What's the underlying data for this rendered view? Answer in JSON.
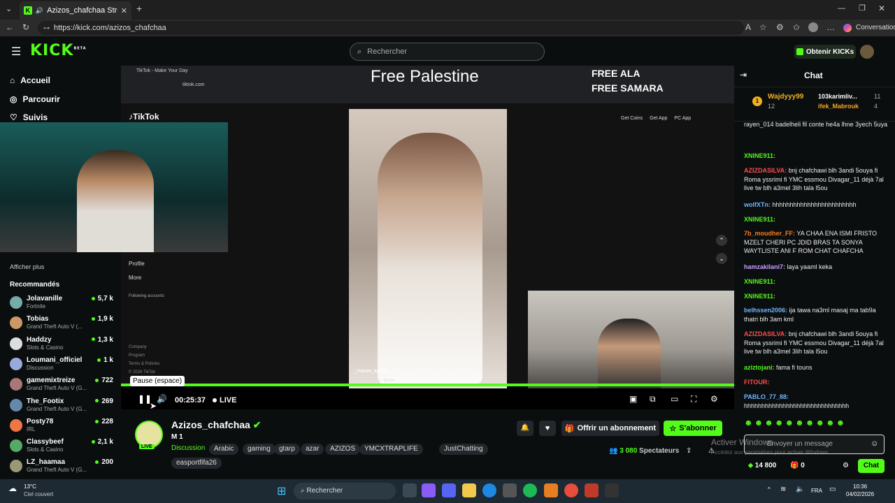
{
  "browser": {
    "tab_title": "Azizos_chafchaa Stream - Wa",
    "url": "https://kick.com/azizos_chafchaa",
    "conversation_label": "Conversation"
  },
  "header": {
    "logo": "KICK",
    "logo_beta": "BETA",
    "search_placeholder": "Rechercher",
    "get_kicks": "Obtenir KICKs"
  },
  "sidebar": {
    "nav": [
      "Accueil",
      "Parcourir",
      "Suivis"
    ],
    "show_more": "Afficher plus",
    "recommended_title": "Recommandés",
    "recommended": [
      {
        "name": "Jolavanille",
        "category": "Fortnite",
        "viewers": "5,7 k"
      },
      {
        "name": "Tobias",
        "category": "Grand Theft Auto V (...",
        "viewers": "1,9 k"
      },
      {
        "name": "Haddzy",
        "category": "Slots & Casino",
        "viewers": "1,3 k"
      },
      {
        "name": "Loumani_officiel",
        "category": "Discussion",
        "viewers": "1 k"
      },
      {
        "name": "gamemixtreize",
        "category": "Grand Theft Auto V (G...",
        "viewers": "722"
      },
      {
        "name": "The_Footix",
        "category": "Grand Theft Auto V (G...",
        "viewers": "269"
      },
      {
        "name": "Posty78",
        "category": "IRL",
        "viewers": "228"
      },
      {
        "name": "Classybeef",
        "category": "Slots & Casino",
        "viewers": "2,1 k"
      },
      {
        "name": "LZ_haamaa",
        "category": "Grand Theft Auto V (G...",
        "viewers": "200"
      }
    ]
  },
  "video": {
    "overlay_title": "Free Palestine",
    "overlay_line1": "FREE ALA",
    "overlay_line2": "FREE SAMARA",
    "tiktok_logo": "TikTok",
    "tiktok_tab": "TikTok - Make Your Day",
    "tiktok_url": "tiktok.com",
    "tiktok_profile": "Profile",
    "tiktok_more": "More",
    "tiktok_following": "Following accounts",
    "tiktok_get_coins": "Get Coins",
    "tiktok_get_app": "Get App",
    "tiktok_pc_app": "PC App",
    "tiktok_footer": [
      "Company",
      "Program",
      "Terms & Policies",
      "© 2026 TikTok"
    ],
    "tiktok_user": "_marwa_agrebi_",
    "tiktok_sound": "original sound - fyrsae",
    "tooltip": "Pause (espace)",
    "time": "00:25:37",
    "live": "LIVE"
  },
  "stream": {
    "streamer": "Azizos_chafchaa",
    "live_badge": "LIVE",
    "subtitle": "M 1",
    "category": "Discussion",
    "tags": [
      "Arabic",
      "gaming",
      "gtarp",
      "azar",
      "AZIZOS",
      "YMCXTRAPLIFE",
      "JustChatting",
      "easportfifa26"
    ],
    "subscribe_gift": "Offrir un abonnement",
    "subscribe": "S'abonner",
    "viewers": "3 080",
    "viewers_label": "Spectateurs"
  },
  "chat": {
    "title": "Chat",
    "top1_name": "Wajdyyy99",
    "top1_count": "12",
    "top2_name": "103karimliv...",
    "top2_count": "11",
    "top3_name": "ifek_Mabrouk",
    "top3_count": "4",
    "messages": [
      {
        "user": "",
        "text": "rayen_014 badelheli fil conte he4a lhne 3yech 5uya"
      },
      {
        "user": "XNINE911:",
        "text": ""
      },
      {
        "user": "AZIZDASILVA:",
        "text": "bnj chafchawi blh 3andi 5ouya fi Roma yssrimi fi YMC essmou Divagar_11 déjà 7al live tw blh a3mel 3lih tala l5ou"
      },
      {
        "user": "wolfXTn:",
        "text": "hhhhhhhhhhhhhhhhhhhhhhhh"
      },
      {
        "user": "XNINE911:",
        "text": ""
      },
      {
        "user": "7b_moudher_FF:",
        "text": "YA CHAA ENA ISMI FRISTO MZELT CHERI PC JDID BRAS TA SONYA WAYTLISTE ANI F ROM CHAT CHAFCHA"
      },
      {
        "user": "hamzakilani7:",
        "text": "laya yaaml keka"
      },
      {
        "user": "XNINE911:",
        "text": ""
      },
      {
        "user": "XNINE911:",
        "text": ""
      },
      {
        "user": "belhssen2006:",
        "text": "ija tawa na3ml masaj ma tab9a thatri blh 3am kml"
      },
      {
        "user": "AZIZDASILVA:",
        "text": "bnj chafchawi blh 3andi 5ouya fi Roma yssrimi fi YMC essmou Divagar_11 déjà 7al live tw blh a3mel 3lih tala l5ou"
      },
      {
        "user": "aziztojani:",
        "text": "fama fi touns"
      },
      {
        "user": "FITOUR:",
        "text": ""
      },
      {
        "user": "PABLO_77_88:",
        "text": "hhhhhhhhhhhhhhhhhhhhhhhhhhhhhh"
      }
    ],
    "input_placeholder": "Envoyer un message",
    "points": "14 800",
    "gifts": "0",
    "chat_button": "Chat",
    "watermark1": "Activer Windows",
    "watermark2": "Accédez aux paramètres pour activer Windows."
  },
  "taskbar": {
    "weather_temp": "13°C",
    "weather_desc": "Ciel couvert",
    "search": "Rechercher",
    "lang": "FRA",
    "time": "10:36",
    "date": "04/02/2026"
  }
}
